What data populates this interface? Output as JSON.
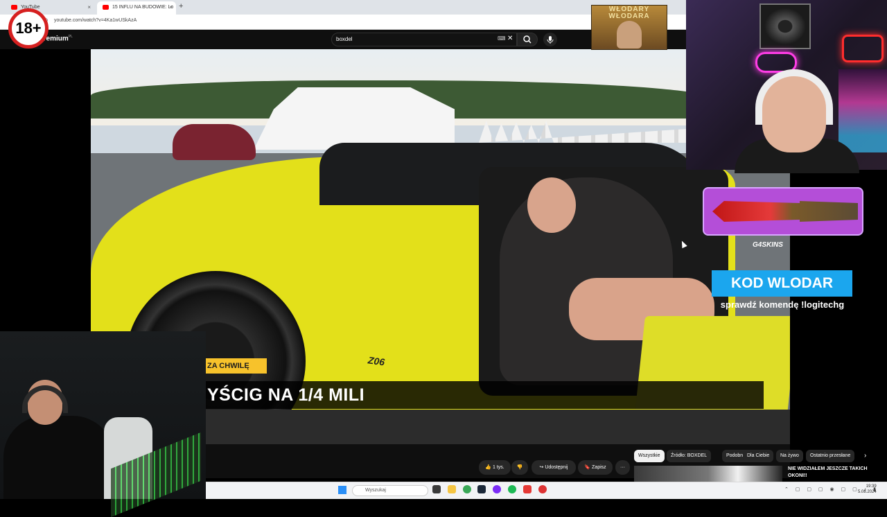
{
  "browser": {
    "tabs": [
      {
        "label": "YouTube"
      },
      {
        "label": "15 INFLU NA BUDOWIE: Lo"
      }
    ],
    "new_tab": "+",
    "tab_close": "×",
    "url": "youtube.com/watch?v=4Ka1wUSkAzA"
  },
  "youtube": {
    "logo": "Premium",
    "logo_region": "PL",
    "search_value": "boxdel",
    "clear": "✕",
    "actions": {
      "likes": "👍 1 tys.",
      "dislike": "👎",
      "share": "↪ Udostępnij",
      "save": "🔖 Zapisz",
      "more": "···"
    },
    "chips": [
      "Wszystkie",
      "Źródło: BOXDEL",
      "Podobne",
      "Dla Ciebie",
      "Na żywo",
      "Ostatnio przesłane"
    ],
    "chips_next": "›",
    "related_title": "NIE WIDZIAŁEM JESZCZE TAKICH OKONI!!"
  },
  "video": {
    "overlay_small": "ZA CHWILĘ",
    "overlay_title": "YŚCIG NA 1/4 MILI",
    "car_badge": "Z06"
  },
  "stream": {
    "age_badge": "18+",
    "poster_text": "WŁODARY WŁODARA",
    "skin_logo": "G4SKINS",
    "promo_code": "KOD WLODAR",
    "promo_sub": "sprawdź komendę !logitechg"
  },
  "taskbar": {
    "search_placeholder": "Wyszukaj",
    "time": "19:39",
    "date": "5.08.2024"
  },
  "colors": {
    "youtube_bg": "#0f0f0f",
    "promo_blue": "#1ba6ee",
    "skin_purple": "#b44ed8",
    "overlay_yellow": "#f7c22b",
    "badge_red": "#d62020"
  }
}
